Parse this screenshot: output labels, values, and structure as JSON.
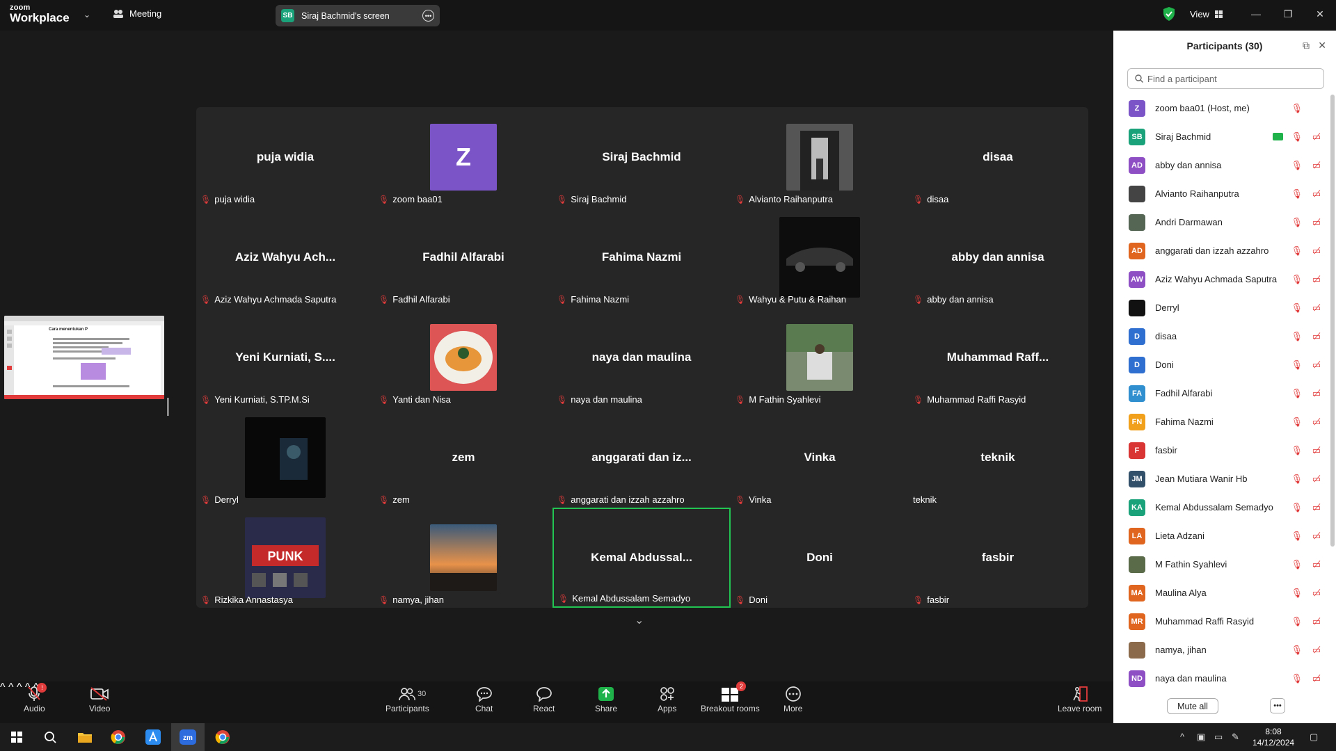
{
  "topbar": {
    "logo_line1": "zoom",
    "logo_line2": "Workplace",
    "meeting_label": "Meeting",
    "share_initials": "SB",
    "share_label": "Siraj Bachmid's screen",
    "view_label": "View"
  },
  "gallery": {
    "tiles": [
      {
        "big": "puja widia",
        "label": "puja widia",
        "muted": true
      },
      {
        "big": "",
        "label": "zoom baa01",
        "muted": true,
        "avatar": "Z"
      },
      {
        "big": "Siraj Bachmid",
        "label": "Siraj Bachmid",
        "muted": true
      },
      {
        "big": "",
        "label": "Alvianto Raihanputra",
        "muted": true,
        "photo": "hallway"
      },
      {
        "big": "disaa",
        "label": "disaa",
        "muted": true
      },
      {
        "big": "Aziz Wahyu  Ach...",
        "label": "Aziz Wahyu  Achmada Saputra",
        "muted": true
      },
      {
        "big": "Fadhil Alfarabi",
        "label": "Fadhil Alfarabi",
        "muted": true
      },
      {
        "big": "Fahima Nazmi",
        "label": "Fahima Nazmi",
        "muted": true
      },
      {
        "big": "",
        "label": "Wahyu & Putu & Raihan",
        "muted": true,
        "photo": "car"
      },
      {
        "big": "abby dan annisa",
        "label": "abby dan annisa",
        "muted": true
      },
      {
        "big": "Yeni Kurniati, S....",
        "label": "Yeni Kurniati, S.TP.M.Si",
        "muted": true
      },
      {
        "big": "",
        "label": "Yanti dan Nisa",
        "muted": true,
        "photo": "food"
      },
      {
        "big": "naya dan maulina",
        "label": "naya dan maulina",
        "muted": true
      },
      {
        "big": "",
        "label": "M Fathin Syahlevi",
        "muted": true,
        "photo": "park"
      },
      {
        "big": "Muhammad  Raff...",
        "label": "Muhammad Raffi Rasyid",
        "muted": true
      },
      {
        "big": "",
        "label": "Derryl",
        "muted": true,
        "photo": "dark"
      },
      {
        "big": "zem",
        "label": "zem",
        "muted": true
      },
      {
        "big": "anggarati dan iz...",
        "label": "anggarati dan izzah azzahro",
        "muted": true
      },
      {
        "big": "Vinka",
        "label": "Vinka",
        "muted": true
      },
      {
        "big": "teknik",
        "label": "teknik",
        "muted": false
      },
      {
        "big": "",
        "label": "Rizkika Annastasya",
        "muted": true,
        "photo": "punk"
      },
      {
        "big": "",
        "label": "namya, jihan",
        "muted": true,
        "photo": "sunset"
      },
      {
        "big": "Kemal  Abdussal...",
        "label": "Kemal Abdussalam Semadyo",
        "muted": true,
        "active": true
      },
      {
        "big": "Doni",
        "label": "Doni",
        "muted": true
      },
      {
        "big": "fasbir",
        "label": "fasbir",
        "muted": true
      }
    ]
  },
  "shared_thumb": {
    "heading": "Cara menentukan P"
  },
  "participants_panel": {
    "title": "Participants (30)",
    "search_placeholder": "Find a participant",
    "mute_all_label": "Mute all",
    "items": [
      {
        "initials": "Z",
        "name": "zoom baa01 (Host, me)",
        "color": "#7b55c7",
        "video": false
      },
      {
        "initials": "SB",
        "name": "Siraj Bachmid",
        "color": "#1aa37a",
        "video": true,
        "sharing": true
      },
      {
        "initials": "AD",
        "name": "abby dan annisa",
        "color": "#8e4fc4",
        "video": true
      },
      {
        "initials": "",
        "name": "Alvianto Raihanputra",
        "color": "#444444",
        "video": true,
        "photo": true
      },
      {
        "initials": "",
        "name": "Andri Darmawan",
        "color": "#556655",
        "video": true,
        "photo": true
      },
      {
        "initials": "AD",
        "name": "anggarati dan izzah azzahro",
        "color": "#e0661f",
        "video": true
      },
      {
        "initials": "AW",
        "name": "Aziz Wahyu  Achmada Saputra",
        "color": "#8e4fc4",
        "video": true
      },
      {
        "initials": "",
        "name": "Derryl",
        "color": "#111111",
        "video": true,
        "photo": true
      },
      {
        "initials": "D",
        "name": "disaa",
        "color": "#2f6fcf",
        "video": true
      },
      {
        "initials": "D",
        "name": "Doni",
        "color": "#2f6fcf",
        "video": true
      },
      {
        "initials": "FA",
        "name": "Fadhil Alfarabi",
        "color": "#2f8fcf",
        "video": true
      },
      {
        "initials": "FN",
        "name": "Fahima Nazmi",
        "color": "#f0a01a",
        "video": true
      },
      {
        "initials": "F",
        "name": "fasbir",
        "color": "#d93535",
        "video": true
      },
      {
        "initials": "JM",
        "name": "Jean Mutiara Wanir Hb",
        "color": "#33506b",
        "video": true
      },
      {
        "initials": "KA",
        "name": "Kemal Abdussalam Semadyo",
        "color": "#1aa37a",
        "video": true
      },
      {
        "initials": "LA",
        "name": "Lieta Adzani",
        "color": "#e0661f",
        "video": true
      },
      {
        "initials": "",
        "name": "M Fathin Syahlevi",
        "color": "#5a6b4a",
        "video": true,
        "photo": true
      },
      {
        "initials": "MA",
        "name": "Maulina Alya",
        "color": "#e0661f",
        "video": true
      },
      {
        "initials": "MR",
        "name": "Muhammad Raffi Rasyid",
        "color": "#e0661f",
        "video": true
      },
      {
        "initials": "",
        "name": "namya, jihan",
        "color": "#8a6a4a",
        "video": true,
        "photo": true
      },
      {
        "initials": "ND",
        "name": "naya dan maulina",
        "color": "#8e4fc4",
        "video": true
      }
    ]
  },
  "toolbar": {
    "audio": "Audio",
    "video": "Video",
    "participants": "Participants",
    "participants_count": "30",
    "chat": "Chat",
    "react": "React",
    "share": "Share",
    "apps": "Apps",
    "breakout": "Breakout rooms",
    "breakout_badge": "2",
    "more": "More",
    "leave": "Leave room"
  },
  "taskbar": {
    "time": "8:08",
    "date": "14/12/2024"
  },
  "colors": {
    "accent_green": "#23c552",
    "mute_red": "#e23b3b"
  }
}
